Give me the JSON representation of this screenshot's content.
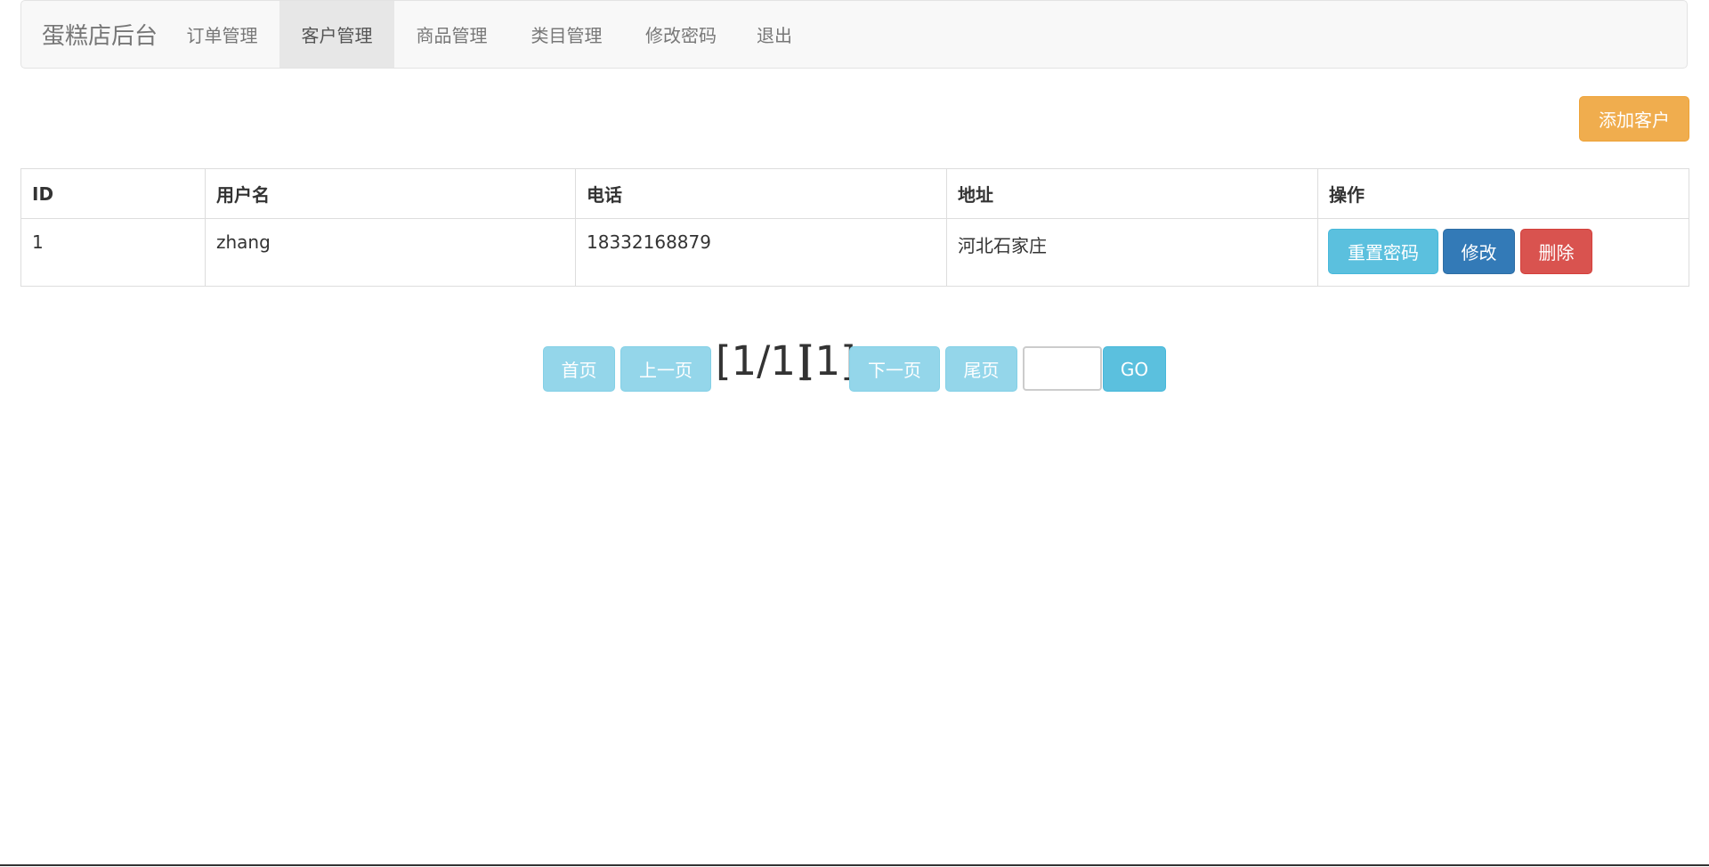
{
  "navbar": {
    "brand": "蛋糕店后台",
    "items": [
      {
        "label": "订单管理"
      },
      {
        "label": "客户管理"
      },
      {
        "label": "商品管理"
      },
      {
        "label": "类目管理"
      },
      {
        "label": "修改密码"
      },
      {
        "label": "退出"
      }
    ],
    "active_item": "客户管理"
  },
  "toolbar": {
    "add_customer_label": "添加客户"
  },
  "table": {
    "headers": [
      "ID",
      "用户名",
      "电话",
      "地址",
      "操作"
    ],
    "rows": [
      {
        "id": "1",
        "username": "zhang",
        "phone": "18332168879",
        "address": "河北石家庄",
        "actions": {
          "reset_password": "重置密码",
          "edit": "修改",
          "delete": "删除"
        }
      }
    ]
  },
  "pagination": {
    "first_label": "首页",
    "prev_label": "上一页",
    "page_info": "[1/1]",
    "current_page": "[1]",
    "next_label": "下一页",
    "last_label": "尾页",
    "jump_value": "",
    "go_label": "GO"
  },
  "colors": {
    "warning": "#f0ad4e",
    "info": "#5bc0de",
    "primary": "#337ab7",
    "danger": "#d9534f",
    "navbar_bg": "#f8f8f8"
  }
}
